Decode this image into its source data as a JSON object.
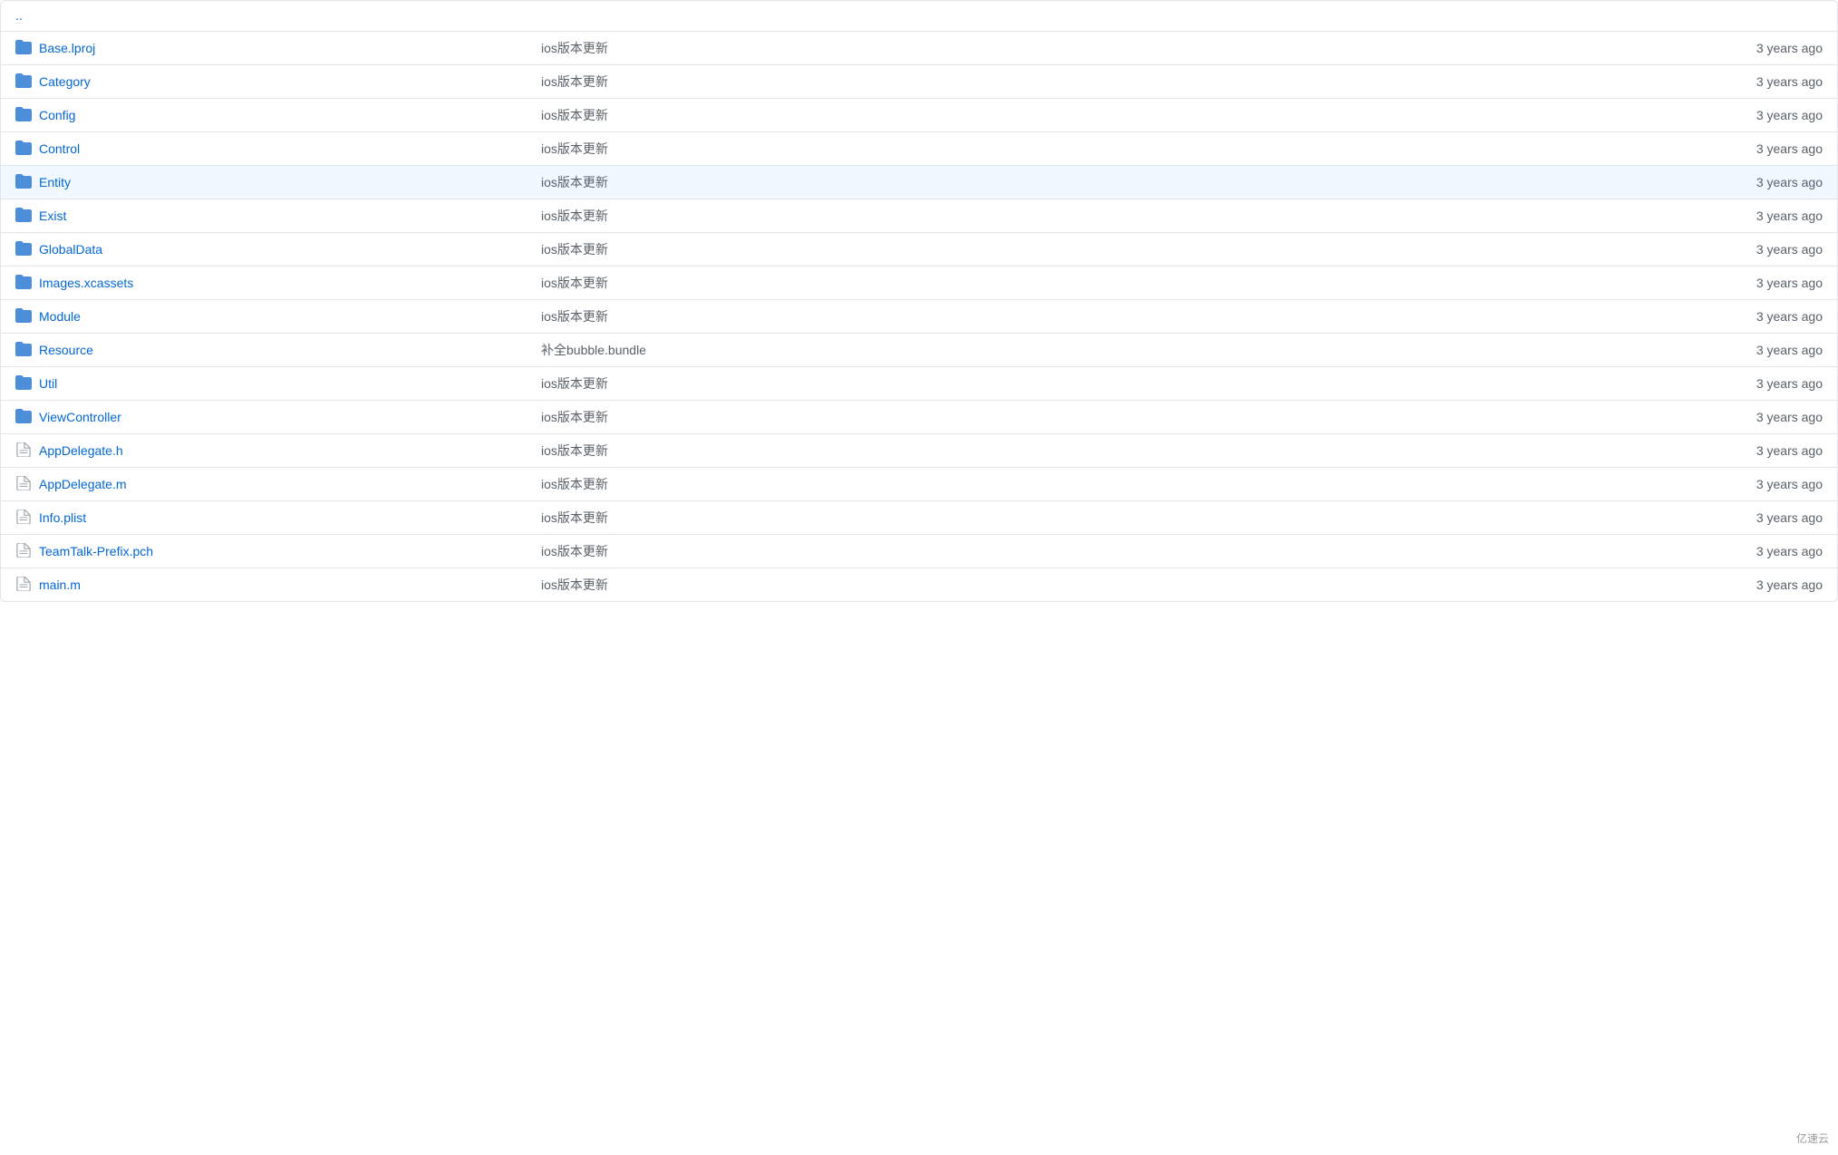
{
  "parent": {
    "label": ".."
  },
  "rows": [
    {
      "type": "folder",
      "name": "Base.lproj",
      "message": "ios版本更新",
      "time": "3 years ago",
      "highlighted": false
    },
    {
      "type": "folder",
      "name": "Category",
      "message": "ios版本更新",
      "time": "3 years ago",
      "highlighted": false
    },
    {
      "type": "folder",
      "name": "Config",
      "message": "ios版本更新",
      "time": "3 years ago",
      "highlighted": false
    },
    {
      "type": "folder",
      "name": "Control",
      "message": "ios版本更新",
      "time": "3 years ago",
      "highlighted": false
    },
    {
      "type": "folder",
      "name": "Entity",
      "message": "ios版本更新",
      "time": "3 years ago",
      "highlighted": true
    },
    {
      "type": "folder",
      "name": "Exist",
      "message": "ios版本更新",
      "time": "3 years ago",
      "highlighted": false
    },
    {
      "type": "folder",
      "name": "GlobalData",
      "message": "ios版本更新",
      "time": "3 years ago",
      "highlighted": false
    },
    {
      "type": "folder",
      "name": "Images.xcassets",
      "message": "ios版本更新",
      "time": "3 years ago",
      "highlighted": false
    },
    {
      "type": "folder",
      "name": "Module",
      "message": "ios版本更新",
      "time": "3 years ago",
      "highlighted": false
    },
    {
      "type": "folder",
      "name": "Resource",
      "message": "补全bubble.bundle",
      "time": "3 years ago",
      "highlighted": false
    },
    {
      "type": "folder",
      "name": "Util",
      "message": "ios版本更新",
      "time": "3 years ago",
      "highlighted": false
    },
    {
      "type": "folder",
      "name": "ViewController",
      "message": "ios版本更新",
      "time": "3 years ago",
      "highlighted": false
    },
    {
      "type": "file",
      "name": "AppDelegate.h",
      "message": "ios版本更新",
      "time": "3 years ago",
      "highlighted": false
    },
    {
      "type": "file",
      "name": "AppDelegate.m",
      "message": "ios版本更新",
      "time": "3 years ago",
      "highlighted": false
    },
    {
      "type": "file",
      "name": "Info.plist",
      "message": "ios版本更新",
      "time": "3 years ago",
      "highlighted": false
    },
    {
      "type": "file",
      "name": "TeamTalk-Prefix.pch",
      "message": "ios版本更新",
      "time": "3 years ago",
      "highlighted": false
    },
    {
      "type": "file",
      "name": "main.m",
      "message": "ios版本更新",
      "time": "3 years ago",
      "highlighted": false
    }
  ],
  "watermark": "亿速云"
}
